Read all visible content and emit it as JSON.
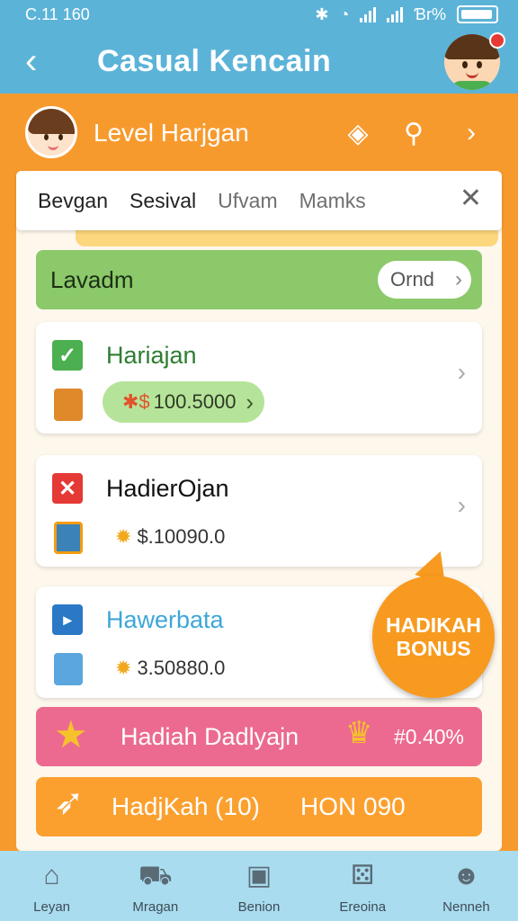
{
  "status": {
    "time": "C.11 160",
    "right": "Ɓr%"
  },
  "app": {
    "title": "Casual Kencain"
  },
  "header": {
    "level_title": "Level Harjgan"
  },
  "tabs": [
    {
      "label": "Bevgan",
      "active": true
    },
    {
      "label": "Sesival",
      "active": true
    },
    {
      "label": "Ufvam",
      "active": false
    },
    {
      "label": "Mamks",
      "active": false
    }
  ],
  "banner": {
    "label": "Lavadm",
    "button": "Ornd"
  },
  "cards": [
    {
      "title": "Hariajan",
      "value": "100.5000",
      "value_prefix": "✱$",
      "status": "check",
      "title_color": "#2e7d32"
    },
    {
      "title": "HadierOjan",
      "value": "$.10090.0",
      "status": "cross",
      "title_color": "#111111"
    },
    {
      "title": "Hawerbata",
      "value": "3.50880.0",
      "status": "doc",
      "title_color": "#3ea6d8"
    }
  ],
  "badge": {
    "line1": "HADIKAH",
    "line2": "BONUS"
  },
  "pink_bar": {
    "label": "Hadiah Dadlyajn",
    "percent": "#0.40%"
  },
  "cta": {
    "left": "HadjKah (10)",
    "right": "HON 090"
  },
  "nav": [
    {
      "label": "Leyan",
      "icon": "home-icon"
    },
    {
      "label": "Mragan",
      "icon": "cart-icon"
    },
    {
      "label": "Benion",
      "icon": "box-icon"
    },
    {
      "label": "Ereoina",
      "icon": "game-icon"
    },
    {
      "label": "Nenneh",
      "icon": "profile-icon"
    }
  ],
  "colors": {
    "primary": "#5cb3d8",
    "accent": "#f79a2e",
    "green": "#8bc96a",
    "pink": "#ec6a8f",
    "nav": "#a9dcef"
  }
}
